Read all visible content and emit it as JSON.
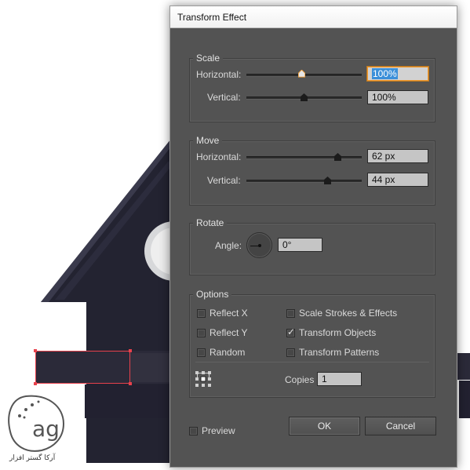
{
  "dialog": {
    "title": "Transform Effect",
    "scale": {
      "title": "Scale",
      "horizontal_label": "Horizontal:",
      "horizontal_value": "100%",
      "vertical_label": "Vertical:",
      "vertical_value": "100%"
    },
    "move": {
      "title": "Move",
      "horizontal_label": "Horizontal:",
      "horizontal_value": "62 px",
      "vertical_label": "Vertical:",
      "vertical_value": "44 px"
    },
    "rotate": {
      "title": "Rotate",
      "angle_label": "Angle:",
      "angle_value": "0°"
    },
    "options": {
      "title": "Options",
      "reflect_x": "Reflect X",
      "reflect_y": "Reflect Y",
      "random": "Random",
      "scale_strokes": "Scale Strokes & Effects",
      "transform_objects": "Transform Objects",
      "transform_patterns": "Transform Patterns",
      "copies_label": "Copies",
      "copies_value": "1",
      "checked": {
        "reflect_x": false,
        "reflect_y": false,
        "random": false,
        "scale_strokes": false,
        "transform_objects": true,
        "transform_patterns": false
      }
    },
    "preview_label": "Preview",
    "ok_label": "OK",
    "cancel_label": "Cancel"
  },
  "colors": {
    "dialog_bg": "#535353",
    "selection": "#e8414c",
    "highlight": "#3b8fd9",
    "active_border": "#f29a2e"
  },
  "logo": {
    "text": "آرکا گستر افزار"
  }
}
